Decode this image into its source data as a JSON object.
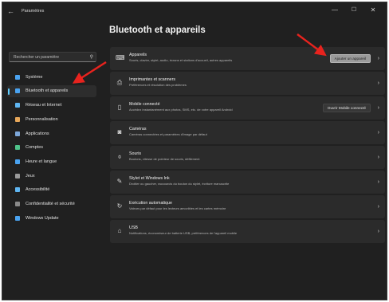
{
  "window": {
    "title": "Paramètres",
    "controls": {
      "minimize": "—",
      "maximize": "☐",
      "close": "✕"
    },
    "back_icon": "back-arrow-icon"
  },
  "sidebar": {
    "search": {
      "placeholder": "Rechercher un paramètre",
      "icon": "search-icon"
    },
    "items": [
      {
        "label": "Système",
        "icon": "monitor-icon",
        "color": "#4aa3f0",
        "active": false
      },
      {
        "label": "Bluetooth et appareils",
        "icon": "bluetooth-icon",
        "color": "#4aa3f0",
        "active": true
      },
      {
        "label": "Réseau et Internet",
        "icon": "wifi-icon",
        "color": "#5fb6f2",
        "active": false
      },
      {
        "label": "Personnalisation",
        "icon": "brush-icon",
        "color": "#e8a85a",
        "active": false
      },
      {
        "label": "Applications",
        "icon": "apps-icon",
        "color": "#7da7d9",
        "active": false
      },
      {
        "label": "Comptes",
        "icon": "person-icon",
        "color": "#4fc38a",
        "active": false
      },
      {
        "label": "Heure et langue",
        "icon": "globe-clock-icon",
        "color": "#4aa3f0",
        "active": false
      },
      {
        "label": "Jeux",
        "icon": "gamepad-icon",
        "color": "#9a9a9a",
        "active": false
      },
      {
        "label": "Accessibilité",
        "icon": "accessibility-icon",
        "color": "#5fb6f2",
        "active": false
      },
      {
        "label": "Confidentialité et sécurité",
        "icon": "shield-icon",
        "color": "#8a8a8a",
        "active": false
      },
      {
        "label": "Windows Update",
        "icon": "update-icon",
        "color": "#4aa3f0",
        "active": false
      }
    ]
  },
  "main": {
    "title": "Bluetooth et appareils",
    "cards": [
      {
        "title": "Appareils",
        "subtitle": "Souris, clavier, stylet, audio, écrans et stations d'accueil, autres appareils",
        "icon": "devices-icon",
        "glyph": "⌨",
        "button": "Ajouter un appareil"
      },
      {
        "title": "Imprimantes et scanners",
        "subtitle": "Préférences et résolution des problèmes",
        "icon": "printer-icon",
        "glyph": "⎙",
        "button": ""
      },
      {
        "title": "Mobile connecté",
        "subtitle": "Accédez instantanément aux photos, SMS, etc. de votre appareil Android",
        "icon": "phone-icon",
        "glyph": "▯",
        "button": "Ouvrir Mobile connecté"
      },
      {
        "title": "Caméras",
        "subtitle": "Caméras connectées et paramètres d'image par défaut",
        "icon": "camera-icon",
        "glyph": "◙",
        "button": ""
      },
      {
        "title": "Souris",
        "subtitle": "Boutons, vitesse de pointeur de souris, défilement",
        "icon": "mouse-icon",
        "glyph": "⌽",
        "button": ""
      },
      {
        "title": "Stylet et Windows Ink",
        "subtitle": "Droitier ou gaucher, raccourcis du bouton du stylet, écriture manuscrite",
        "icon": "pen-icon",
        "glyph": "✎",
        "button": ""
      },
      {
        "title": "Exécution automatique",
        "subtitle": "Valeurs par défaut pour les lecteurs amovibles et les cartes mémoire",
        "icon": "autoplay-icon",
        "glyph": "↻",
        "button": ""
      },
      {
        "title": "USB",
        "subtitle": "Notifications, économiseur de batterie USB, préférences de l'appareil mobile",
        "icon": "usb-icon",
        "glyph": "⌂",
        "button": ""
      }
    ],
    "chevron": "›"
  },
  "colors": {
    "accent": "#60cdff",
    "background": "#202020",
    "card": "#2b2b2b",
    "arrow": "#e8231e"
  }
}
